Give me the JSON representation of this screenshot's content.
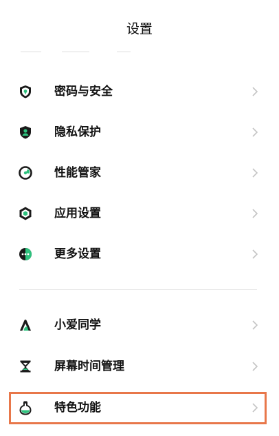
{
  "header": {
    "title": "设置"
  },
  "menu_group_1": [
    {
      "label": "密码与安全",
      "icon": "shield-lock-icon"
    },
    {
      "label": "隐私保护",
      "icon": "privacy-shield-icon"
    },
    {
      "label": "性能管家",
      "icon": "performance-gauge-icon"
    },
    {
      "label": "应用设置",
      "icon": "hexagon-app-icon"
    },
    {
      "label": "更多设置",
      "icon": "more-dots-icon"
    }
  ],
  "menu_group_2": [
    {
      "label": "小爱同学",
      "icon": "xiaoai-assistant-icon"
    },
    {
      "label": "屏幕时间管理",
      "icon": "hourglass-icon"
    },
    {
      "label": "特色功能",
      "icon": "flask-icon"
    }
  ],
  "colors": {
    "icon_dark": "#1a1a1a",
    "icon_accent": "#2ec27e",
    "highlight_border": "#e8774a",
    "chevron": "#c4c4c4",
    "divider": "#e6e6e6"
  }
}
